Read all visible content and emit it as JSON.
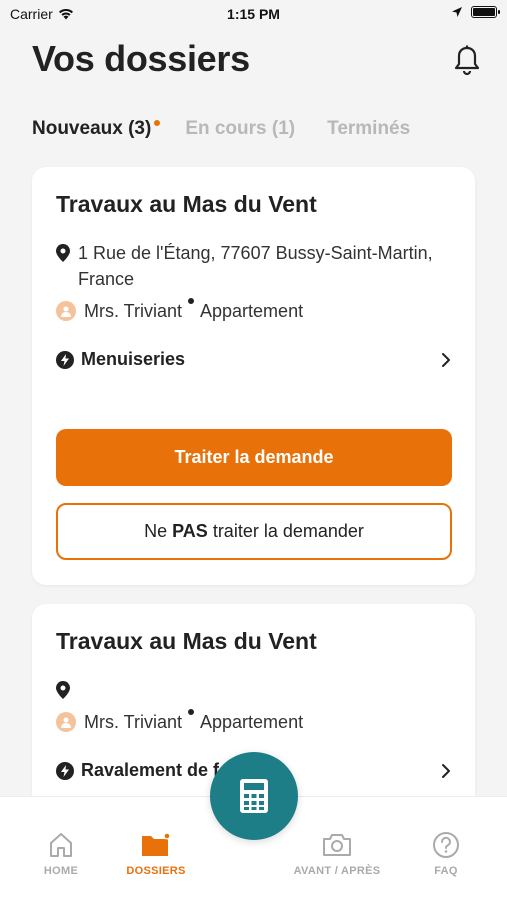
{
  "status_bar": {
    "carrier": "Carrier",
    "time": "1:15 PM"
  },
  "header": {
    "title": "Vos dossiers"
  },
  "tabs": [
    {
      "label": "Nouveaux (3)",
      "active": true,
      "has_dot": true
    },
    {
      "label": "En cours (1)",
      "active": false
    },
    {
      "label": "Terminés",
      "active": false
    }
  ],
  "cards": [
    {
      "title": "Travaux au Mas du Vent",
      "address_line1": "1 Rue de l'Étang, 77607 Bussy-Saint-Martin,",
      "address_line2": "France",
      "client": "Mrs. Triviant",
      "property_type": "Appartement",
      "category": "Menuiseries",
      "primary_action": "Traiter la demande",
      "secondary_action_pre": "Ne ",
      "secondary_action_bold": "PAS",
      "secondary_action_post": " traiter la demander"
    },
    {
      "title": "Travaux au Mas du Vent",
      "address_line1": "",
      "client": "Mrs. Triviant",
      "property_type": "Appartement",
      "category": "Ravalement de f"
    }
  ],
  "tabbar": [
    {
      "label": "HOME",
      "icon": "home-icon",
      "active": false
    },
    {
      "label": "DOSSIERS",
      "icon": "folder-icon",
      "active": true
    },
    {
      "label": "AVANT / APRÈS",
      "icon": "camera-icon",
      "active": false
    },
    {
      "label": "FAQ",
      "icon": "help-icon",
      "active": false
    }
  ],
  "fab": {
    "icon": "calculator-icon"
  },
  "colors": {
    "accent": "#e8710a",
    "fab": "#1d7e88",
    "background": "#f4f4f4"
  }
}
